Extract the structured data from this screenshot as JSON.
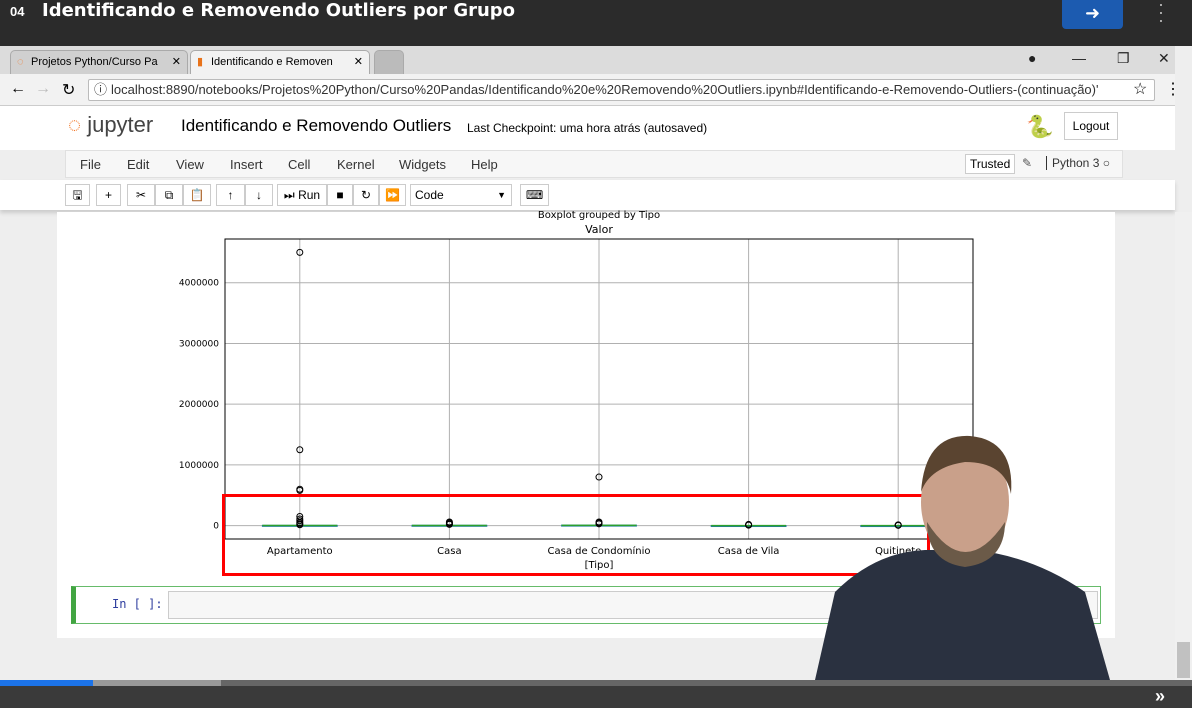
{
  "course": {
    "lesson_number": "04",
    "lesson_title": "Identificando e Removendo Outliers por Grupo",
    "next_icon": "arrow-right-circle-icon",
    "fast_forward": "»",
    "progress_fraction": 0.08
  },
  "browser": {
    "tabs": [
      {
        "label": "Projetos Python/Curso Pa",
        "icon": "jupyter-icon"
      },
      {
        "label": "Identificando e Removen",
        "icon": "notebook-icon",
        "active": true
      }
    ],
    "url_host": "localhost",
    "url": "localhost:8890/notebooks/Projetos%20Python/Curso%20Pandas/Identificando%20e%20Removendo%20Outliers.ipynb#Identificando-e-Removendo-Outliers-(continuação)'"
  },
  "jupyter": {
    "logo": "jupyter",
    "title": "Identificando e Removendo Outliers",
    "checkpoint": "Last Checkpoint: uma hora atrás  (autosaved)",
    "logout": "Logout",
    "menu": [
      "File",
      "Edit",
      "View",
      "Insert",
      "Cell",
      "Kernel",
      "Widgets",
      "Help"
    ],
    "trusted": "Trusted",
    "kernel": "Python 3",
    "toolbar": {
      "run": "Run",
      "cell_type": "Code"
    },
    "cell_prompt": "In [ ]:"
  },
  "chart_data": {
    "type": "boxplot",
    "suptitle": "Boxplot grouped by Tipo",
    "title": "Valor",
    "xlabel": "[Tipo]",
    "ylabel": "",
    "categories": [
      "Apartamento",
      "Casa",
      "Casa de Condomínio",
      "Casa de Vila",
      "Quitinete"
    ],
    "yticks": [
      0,
      1000000,
      2000000,
      3000000,
      4000000
    ],
    "ytick_labels": [
      "0",
      "1000000",
      "2000000",
      "3000000",
      "4000000"
    ],
    "ylim": [
      -220000,
      4720000
    ],
    "grid": true,
    "boxes": [
      {
        "q1": 1000,
        "median": 2500,
        "q3": 5000,
        "whisker_low": 0,
        "whisker_high": 12000,
        "outliers": [
          4500000,
          1250000,
          600000,
          580000,
          150000,
          110000,
          80000,
          50000,
          30000,
          15000
        ]
      },
      {
        "q1": 1000,
        "median": 3000,
        "q3": 6000,
        "whisker_low": 0,
        "whisker_high": 14000,
        "outliers": [
          60000,
          45000,
          30000,
          20000
        ]
      },
      {
        "q1": 2000,
        "median": 5000,
        "q3": 9000,
        "whisker_low": 0,
        "whisker_high": 20000,
        "outliers": [
          800000,
          60000,
          45000,
          30000
        ]
      },
      {
        "q1": 500,
        "median": 1200,
        "q3": 2000,
        "whisker_low": 0,
        "whisker_high": 4000,
        "outliers": [
          20000,
          12000,
          8000
        ]
      },
      {
        "q1": 500,
        "median": 1000,
        "q3": 1500,
        "whisker_low": 0,
        "whisker_high": 3000,
        "outliers": [
          12000,
          8000,
          5000
        ]
      }
    ],
    "highlight_color": "#ff0000",
    "median_color": "#2ca02c",
    "box_color": "#1f77b4"
  }
}
